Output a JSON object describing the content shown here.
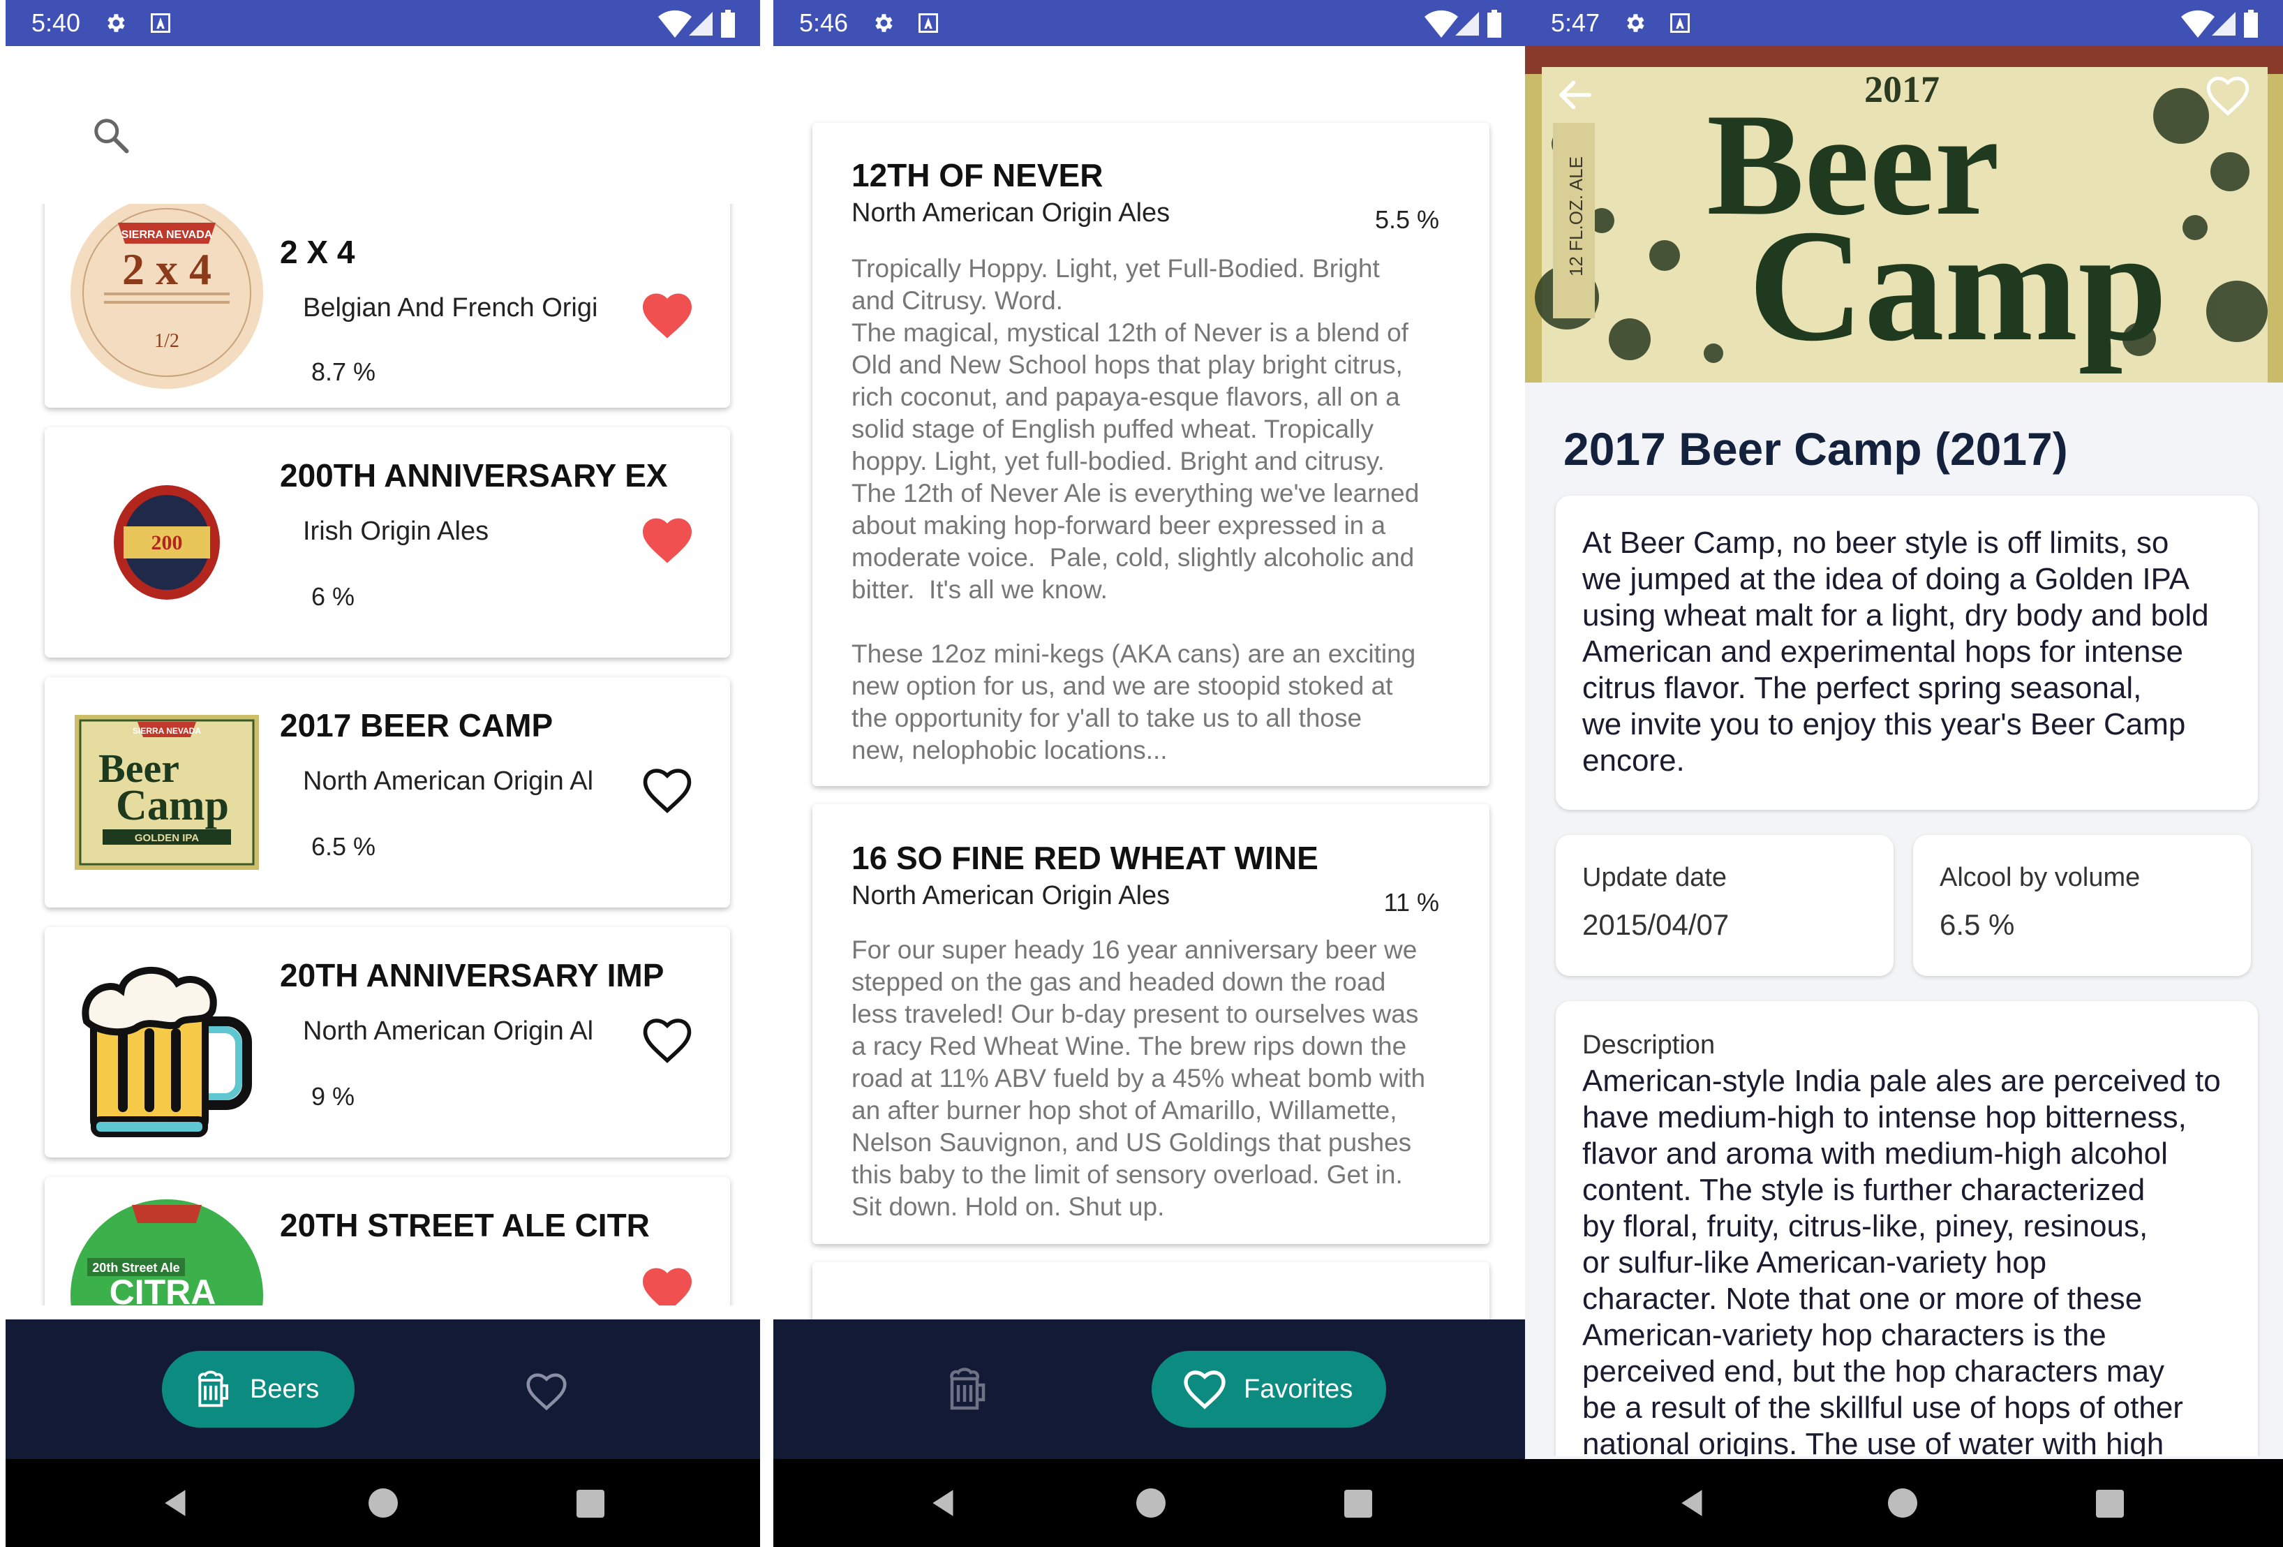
{
  "screen1": {
    "status_time": "5:40",
    "beers": [
      {
        "name": "2 X 4",
        "origin": "Belgian And French Origi",
        "abv": "8.7 %",
        "favorite": true,
        "thumb": "2x4-label"
      },
      {
        "name": "200TH ANNIVERSARY EX",
        "origin": "Irish Origin Ales",
        "abv": "6 %",
        "favorite": true,
        "thumb": "guinness-label"
      },
      {
        "name": "2017 BEER CAMP",
        "origin": "North American Origin Al",
        "abv": "6.5 %",
        "favorite": false,
        "thumb": "beer-camp-label"
      },
      {
        "name": "20TH ANNIVERSARY IMP",
        "origin": "North American Origin Al",
        "abv": "9 %",
        "favorite": false,
        "thumb": "beer-mug-icon"
      },
      {
        "name": "20TH STREET ALE CITR",
        "origin": "",
        "abv": "",
        "favorite": true,
        "thumb": "citra-label"
      }
    ],
    "thumb_texts": {
      "x4_brand": "SIERRA NEVADA",
      "x4_title": "2 x 4",
      "x4_small": "1/2",
      "guinness_text": "200",
      "camp_brand": "SIERRA NEVADA",
      "camp_beer": "Beer",
      "camp_camp": "Camp",
      "camp_ipa": "GOLDEN IPA",
      "citra_sub": "20th Street Ale",
      "citra_main": "CITRA"
    },
    "nav": {
      "beers_label": "Beers"
    }
  },
  "screen2": {
    "status_time": "5:46",
    "favorites": [
      {
        "name": "12TH OF NEVER",
        "origin": "North American Origin Ales",
        "abv": "5.5 %",
        "description": "Tropically Hoppy. Light, yet Full-Bodied. Bright\nand Citrusy. Word.\nThe magical, mystical 12th of Never is a blend of\nOld and New School hops that play bright citrus,\nrich coconut, and papaya-esque flavors, all on a\nsolid stage of English puffed wheat. Tropically\nhoppy. Light, yet full-bodied. Bright and citrusy.\nThe 12th of Never Ale is everything we've learned\nabout making hop-forward beer expressed in a\nmoderate voice.  Pale, cold, slightly alcoholic and\nbitter.  It's all we know.\n\nThese 12oz mini-kegs (AKA cans) are an exciting\nnew option for us, and we are stoopid stoked at\nthe opportunity for y'all to take us to all those\nnew, nelophobic locations..."
      },
      {
        "name": "16 SO FINE RED WHEAT WINE",
        "origin": "North American Origin Ales",
        "abv": "11 %",
        "description": "For our super heady 16 year anniversary beer we\nstepped on the gas and headed down the road\nless traveled! Our b-day present to ourselves was\na racy Red Wheat Wine. The brew rips down the\nroad at 11% ABV fueld by a 45% wheat bomb with\nan after burner hop shot of Amarillo, Willamette,\nNelson Sauvignon, and US Goldings that pushes\nthis baby to the limit of sensory overload. Get in.\nSit down. Hold on. Shut up."
      }
    ],
    "nav": {
      "favorites_label": "Favorites"
    }
  },
  "screen3": {
    "status_time": "5:47",
    "hero_text": {
      "year": "2017",
      "beer": "Beer",
      "camp": "Camp",
      "side_left": "12 FL.OZ. ALE"
    },
    "title": "2017 Beer Camp (2017)",
    "tagline": "At Beer Camp, no beer style is off limits, so\nwe jumped at the idea of doing a Golden IPA\nusing wheat malt for a light, dry body and bold\nAmerican and experimental hops for intense\ncitrus flavor. The perfect spring seasonal,\nwe invite you to enjoy this year's Beer Camp\nencore.",
    "update_date_label": "Update date",
    "update_date_value": "2015/04/07",
    "abv_label": "Alcool by volume",
    "abv_value": "6.5 %",
    "description_label": "Description",
    "description": "American-style India pale ales are perceived to\nhave medium-high to intense hop bitterness,\nflavor and aroma with medium-high alcohol\ncontent. The style is further characterized\nby floral, fruity, citrus-like, piney, resinous,\nor sulfur-like American-variety hop\ncharacter. Note that one or more of these\nAmerican-variety hop characters is the\nperceived end, but the hop characters may\nbe a result of the skillful use of hops of other\nnational origins. The use of water with high"
  },
  "colors": {
    "status_bar": "#3f51b5",
    "bottom_bar": "#121a35",
    "accent_teal": "#0c8c80",
    "heart_red": "#f05050",
    "title_navy": "#14213d"
  }
}
